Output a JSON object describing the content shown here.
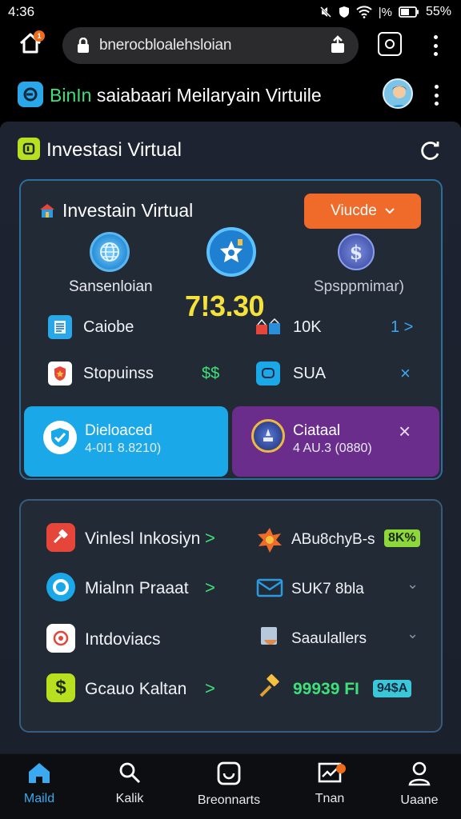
{
  "status": {
    "time": "4:36",
    "battery": "55%",
    "signal_text": "|%"
  },
  "browser": {
    "url": "bnerocbloalehsloian",
    "home_badge": "1"
  },
  "app": {
    "title_prefix": "BinIn",
    "title_rest": " saiabaari Meilaryain Virtuile"
  },
  "section": {
    "title": "Investasi Virtual"
  },
  "card1": {
    "title": "Investain Virtual",
    "dropdown_label": "Viucde",
    "coins": [
      {
        "label": "Sansenloian",
        "icon": "globe-icon"
      },
      {
        "label": "",
        "icon": "star-badge-icon"
      },
      {
        "label": "Spsppmimar)",
        "icon": "dollar-coin-icon"
      }
    ],
    "big_value": "7!3.30",
    "rows": [
      {
        "label": "Caiobe",
        "value": "10K",
        "accent": "1 >"
      },
      {
        "label": "Stopuinss",
        "accent_left": "$$",
        "value": "SUA",
        "accent": "×"
      }
    ],
    "tiles": [
      {
        "title": "Dieloaced",
        "sub": "4-0I1 8.8210)"
      },
      {
        "title": "Ciataal",
        "sub": "4 AU.3 (0880)",
        "close": "×"
      }
    ]
  },
  "card2": {
    "items": [
      {
        "left_label": "Vinlesl Inkosiyn",
        "left_chevron": ">",
        "right_label": "ABu8chyB-s",
        "badge": "8K%"
      },
      {
        "left_label": "Mialnn Praaat",
        "left_chevron": ">",
        "right_label": "SUK7 8bla",
        "right_chevron": "⌄"
      },
      {
        "left_label": "Intdoviacs",
        "left_chevron": "",
        "right_label": "Saaulallers",
        "right_chevron": "⌄"
      },
      {
        "left_label": "Gcauo Kaltan",
        "left_chevron": ">",
        "right_label": "99939 FI",
        "badge": "94$A"
      }
    ]
  },
  "nav": [
    {
      "label": "Maild",
      "icon": "home-icon",
      "active": true
    },
    {
      "label": "Kalik",
      "icon": "search-icon",
      "active": false
    },
    {
      "label": "Breonnarts",
      "icon": "portfolio-icon",
      "active": false
    },
    {
      "label": "Tnan",
      "icon": "chart-icon",
      "active": false
    },
    {
      "label": "Uaane",
      "icon": "user-icon",
      "active": false
    }
  ],
  "colors": {
    "accent_blue": "#1aa8e8",
    "accent_orange": "#f06a2a",
    "accent_green": "#3fe07a",
    "accent_yellow": "#f4e13a",
    "purple": "#6a2d8c"
  }
}
